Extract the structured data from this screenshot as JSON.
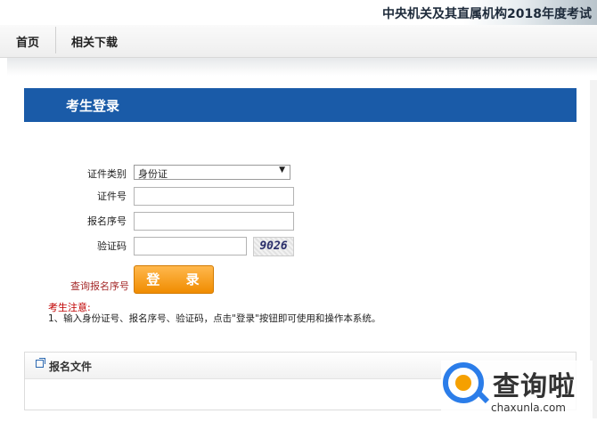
{
  "banner": {
    "title": "中央机关及其直属机构2018年度考试"
  },
  "nav": {
    "home": "首页",
    "downloads": "相关下载"
  },
  "login": {
    "header": "考生登录",
    "id_type_label": "证件类别",
    "id_type_value": "身份证",
    "id_number_label": "证件号",
    "reg_number_label": "报名序号",
    "captcha_label": "验证码",
    "captcha_code": "9026",
    "query_link": "查询报名序号",
    "login_button": "登 录",
    "note_title": "考生注意:",
    "note_body": "1、输入身份证号、报名序号、验证码，点击\"登录\"按钮即可使用和操作本系统。"
  },
  "files": {
    "header": "报名文件"
  },
  "watermark": {
    "brand": "查询啦",
    "domain": "chaxunla.com"
  }
}
